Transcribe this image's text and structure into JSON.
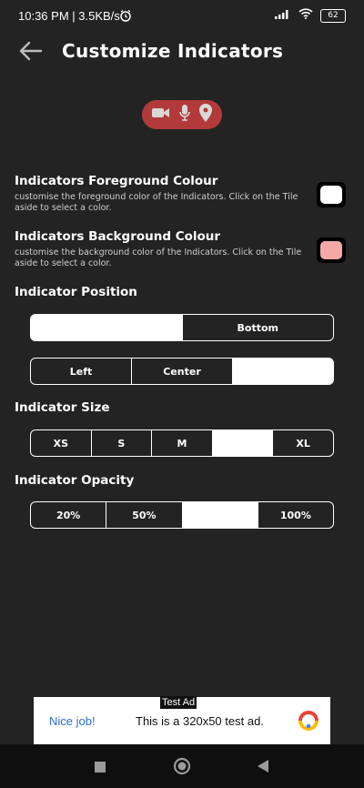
{
  "status": {
    "time": "10:36 PM | 3.5KB/s",
    "battery": "62"
  },
  "appbar": {
    "title": "Customize Indicators"
  },
  "preview": {
    "icons": [
      "video-icon",
      "mic-icon",
      "location-icon"
    ],
    "color": "#b23a3a"
  },
  "foreground": {
    "title": "Indicators Foreground Colour",
    "desc": "customise the foreground color of the Indicators. Click on the Tile aside to select a color.",
    "color": "#ffffff"
  },
  "background": {
    "title": "Indicators Background Colour",
    "desc": "customise the background color of the Indicators. Click on the Tile aside to select a color.",
    "color": "#f4a9a8"
  },
  "position": {
    "title": "Indicator Position",
    "vertical": {
      "options": [
        "",
        "Bottom"
      ],
      "selected_index": 0
    },
    "horizontal": {
      "options": [
        "Left",
        "Center",
        ""
      ],
      "selected_index": 2
    }
  },
  "size": {
    "title": "Indicator Size",
    "options": [
      "XS",
      "S",
      "M",
      "",
      "XL"
    ],
    "selected_index": 3
  },
  "opacity": {
    "title": "Indicator Opacity",
    "options": [
      "20%",
      "50%",
      "",
      "100%"
    ],
    "selected_index": 2
  },
  "ad": {
    "label": "Test Ad",
    "cta": "Nice job!",
    "text": "This is a 320x50 test ad."
  }
}
